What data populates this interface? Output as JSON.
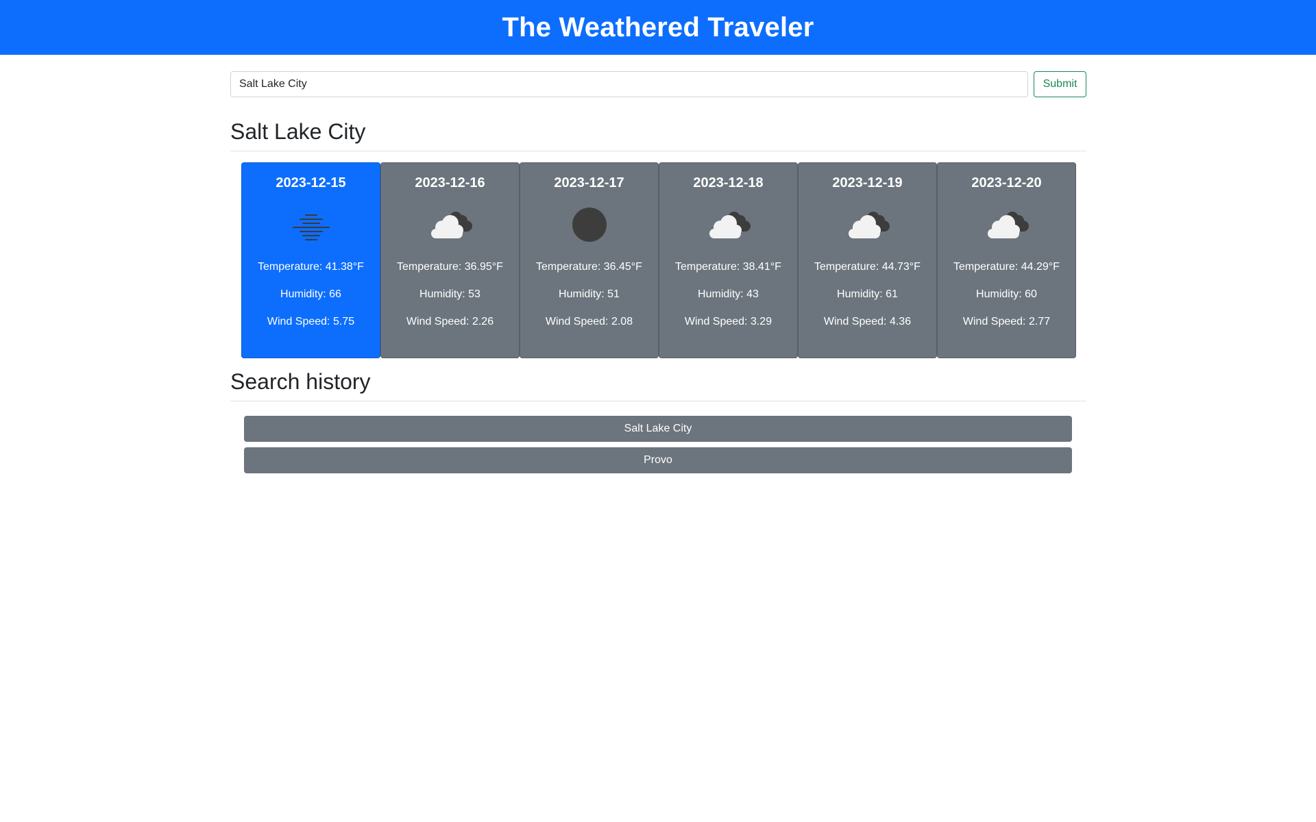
{
  "header": {
    "title": "The Weathered Traveler"
  },
  "search": {
    "value": "Salt Lake City",
    "submit_label": "Submit"
  },
  "forecast": {
    "city": "Salt Lake City",
    "days": [
      {
        "date": "2023-12-15",
        "icon": "mist-icon",
        "temperature": "Temperature: 41.38°F",
        "humidity": "Humidity: 66",
        "wind": "Wind Speed: 5.75",
        "highlight": true
      },
      {
        "date": "2023-12-16",
        "icon": "broken-clouds-icon",
        "temperature": "Temperature: 36.95°F",
        "humidity": "Humidity: 53",
        "wind": "Wind Speed: 2.26",
        "highlight": false
      },
      {
        "date": "2023-12-17",
        "icon": "clear-sky-icon",
        "temperature": "Temperature: 36.45°F",
        "humidity": "Humidity: 51",
        "wind": "Wind Speed: 2.08",
        "highlight": false
      },
      {
        "date": "2023-12-18",
        "icon": "broken-clouds-icon",
        "temperature": "Temperature: 38.41°F",
        "humidity": "Humidity: 43",
        "wind": "Wind Speed: 3.29",
        "highlight": false
      },
      {
        "date": "2023-12-19",
        "icon": "broken-clouds-icon",
        "temperature": "Temperature: 44.73°F",
        "humidity": "Humidity: 61",
        "wind": "Wind Speed: 4.36",
        "highlight": false
      },
      {
        "date": "2023-12-20",
        "icon": "broken-clouds-icon",
        "temperature": "Temperature: 44.29°F",
        "humidity": "Humidity: 60",
        "wind": "Wind Speed: 2.77",
        "highlight": false
      }
    ]
  },
  "history": {
    "title": "Search history",
    "items": [
      "Salt Lake City",
      "Provo"
    ]
  },
  "colors": {
    "primary": "#0d6efd",
    "secondary": "#6c757d",
    "success": "#198754"
  }
}
